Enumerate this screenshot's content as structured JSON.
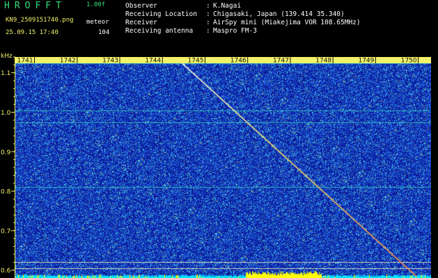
{
  "header": {
    "logo": "HROFFT",
    "version": "1.00f",
    "filename": "KN9_2509151740.png",
    "mode": "meteor",
    "datetime": "25.09.15 17:40",
    "count": "104",
    "info": [
      {
        "key": "Observer",
        "value": "K.Nagai"
      },
      {
        "key": "Receiving Location",
        "value": "Chigasaki, Japan (139.414 35.340)"
      },
      {
        "key": "Receiver",
        "value": "AirSpy mini (Miakejima VOR 108.65MHz)"
      },
      {
        "key": "Receiving antenna",
        "value": "Maspro FM-3"
      }
    ]
  },
  "waterfall": {
    "unit_label": "kHz",
    "y_ticks": [
      "1.1",
      "1.0",
      "0.9",
      "0.8",
      "0.7",
      "0.6"
    ],
    "y_range": [
      0.58,
      1.14
    ],
    "x_ticks": [
      "1741",
      "1742",
      "1743",
      "1744",
      "1745",
      "1746",
      "1747",
      "1748",
      "1749",
      "1750"
    ],
    "x_range": [
      1740.55,
      1750.3
    ],
    "horizontal_lines_khz": [
      1.125,
      1.005,
      0.975,
      0.81,
      0.62,
      0.605
    ],
    "meteor_trace": {
      "start": [
        1744.3,
        1.14
      ],
      "end": [
        1750.0,
        0.58
      ]
    },
    "colors": {
      "background": "#000000",
      "noise_base": "#0b1a9a",
      "axis_label": "#f2f26a",
      "strip": "#00e5ff",
      "strip_burst": "#ffff00"
    }
  }
}
